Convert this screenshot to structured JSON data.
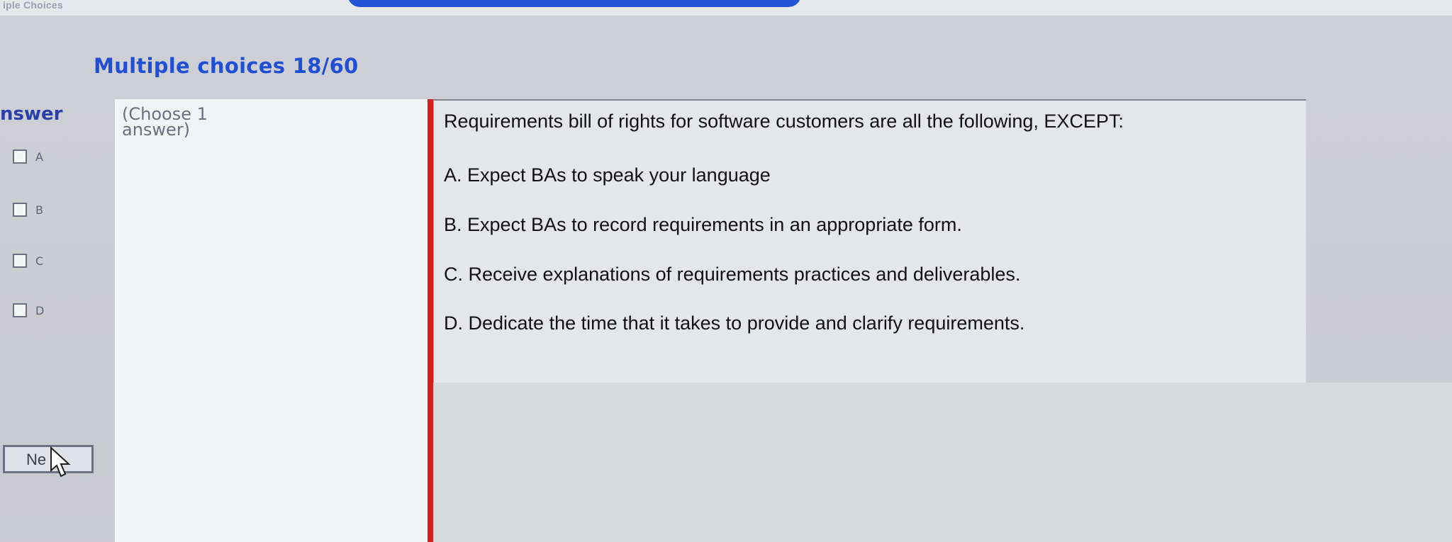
{
  "window": {
    "title": "iple Choices"
  },
  "header": {
    "progress_title": "Multiple choices 18/60"
  },
  "answer_panel": {
    "label": "nswer",
    "choices": [
      {
        "letter": "A"
      },
      {
        "letter": "B"
      },
      {
        "letter": "C"
      },
      {
        "letter": "D"
      }
    ],
    "next_label": "Ne"
  },
  "instruction": {
    "text": "(Choose 1 answer)"
  },
  "question": {
    "text": "Requirements bill of rights for software customers are all the following, EXCEPT:",
    "options": [
      "A. Expect BAs to speak your language",
      "B. Expect BAs to record requirements in an appropriate form.",
      "C. Receive explanations of requirements practices and deliverables.",
      "D. Dedicate the time that it takes to provide and clarify requirements."
    ]
  },
  "colors": {
    "accent_blue": "#1f4fd4",
    "divider_red": "#d11f22"
  },
  "icons": {
    "cursor": "arrow-cursor-icon"
  }
}
